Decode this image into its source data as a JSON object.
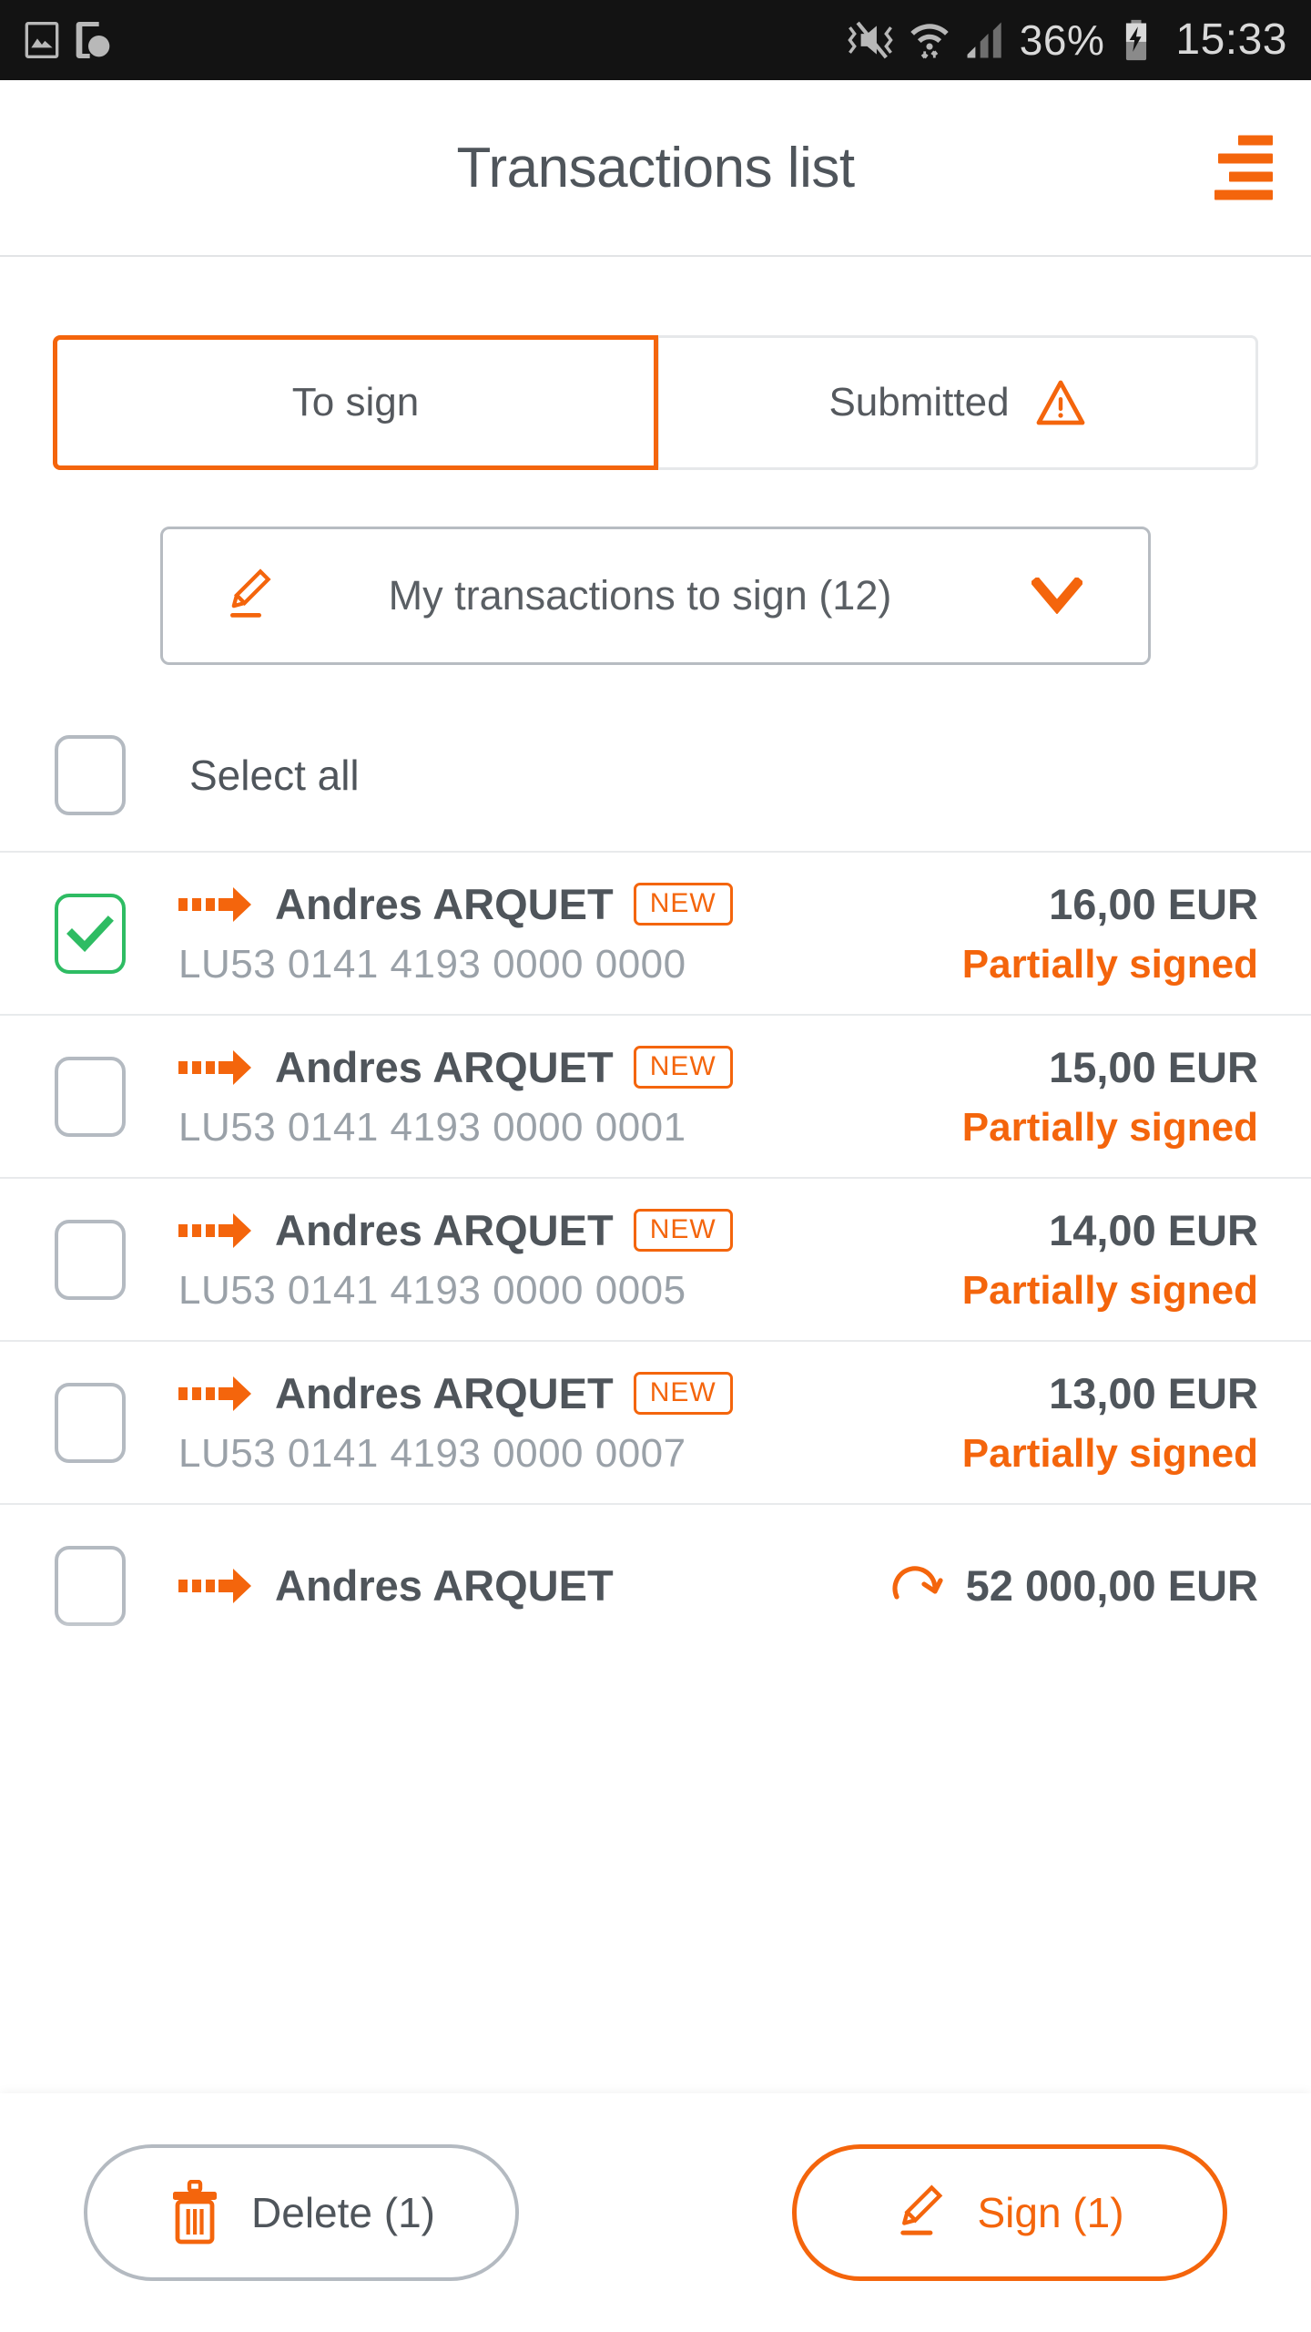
{
  "statusbar": {
    "left_icons": [
      "image-icon",
      "screen-time-icon"
    ],
    "right_icons": [
      "vibrate-off-icon",
      "wifi-icon",
      "signal-icon",
      "battery-charging-icon"
    ],
    "battery_percent": "36%",
    "clock": "15:33"
  },
  "appbar": {
    "title": "Transactions list",
    "menu_icon": "hamburger-menu-icon"
  },
  "tabs": [
    {
      "label": "To sign",
      "active": true,
      "icon": null
    },
    {
      "label": "Submitted",
      "active": false,
      "icon": "warning-triangle-icon"
    }
  ],
  "filter": {
    "icon": "pen-sign-icon",
    "label": "My transactions to sign (12)",
    "chevron": "chevron-down-icon"
  },
  "select_all": {
    "label": "Select all",
    "checked": false
  },
  "transactions": [
    {
      "checked": true,
      "direction_icon": "outgoing-arrow-icon",
      "payee": "Andres ARQUET",
      "badge": "NEW",
      "iban": "LU53 0141 4193 0000 0000",
      "amount": "16,00 EUR",
      "status": "Partially signed",
      "recurring": false
    },
    {
      "checked": false,
      "direction_icon": "outgoing-arrow-icon",
      "payee": "Andres ARQUET",
      "badge": "NEW",
      "iban": "LU53 0141 4193 0000 0001",
      "amount": "15,00 EUR",
      "status": "Partially signed",
      "recurring": false
    },
    {
      "checked": false,
      "direction_icon": "outgoing-arrow-icon",
      "payee": "Andres ARQUET",
      "badge": "NEW",
      "iban": "LU53 0141 4193 0000 0005",
      "amount": "14,00 EUR",
      "status": "Partially signed",
      "recurring": false
    },
    {
      "checked": false,
      "direction_icon": "outgoing-arrow-icon",
      "payee": "Andres ARQUET",
      "badge": "NEW",
      "iban": "LU53 0141 4193 0000 0007",
      "amount": "13,00 EUR",
      "status": "Partially signed",
      "recurring": false
    },
    {
      "checked": false,
      "direction_icon": "outgoing-arrow-icon",
      "payee": "Andres ARQUET",
      "badge": "",
      "iban": "",
      "amount": "52 000,00 EUR",
      "status": "",
      "recurring": true,
      "recurring_icon": "recurring-arrow-icon"
    }
  ],
  "bottom_bar": {
    "delete_label": "Delete (1)",
    "delete_icon": "trash-icon",
    "sign_label": "Sign (1)",
    "sign_icon": "pen-sign-icon"
  },
  "colors": {
    "accent_orange": "#f4650c",
    "text_dark": "#4f555b",
    "text_muted": "#9aa1a8",
    "border_gray": "#b4bac1",
    "check_green": "#2ebc63",
    "statusbar_bg": "#131313"
  }
}
